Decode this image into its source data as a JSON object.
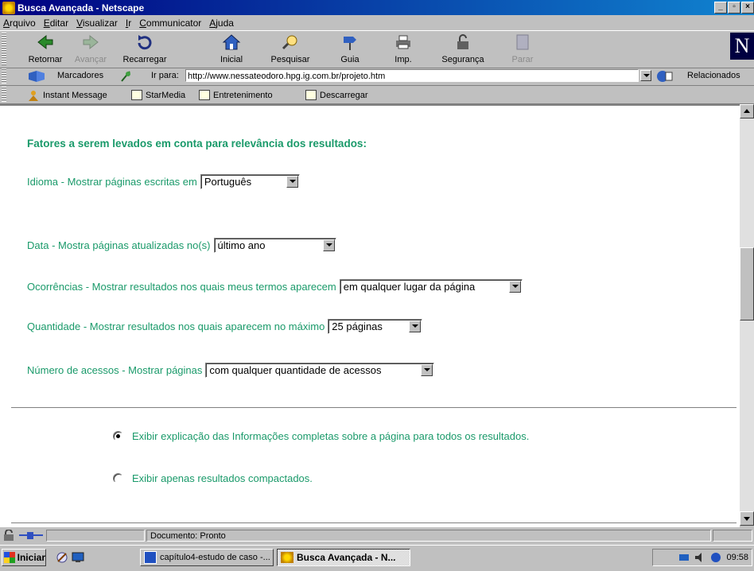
{
  "window": {
    "title": "Busca Avançada - Netscape",
    "buttons": [
      "_",
      "▫",
      "×"
    ]
  },
  "menu": [
    "Arquivo",
    "Editar",
    "Visualizar",
    "Ir",
    "Communicator",
    "Ajuda"
  ],
  "toolbar": {
    "buttons": [
      {
        "label": "Retornar",
        "icon": "back-arrow-icon",
        "enabled": true
      },
      {
        "label": "Avançar",
        "icon": "forward-arrow-icon",
        "enabled": false
      },
      {
        "label": "Recarregar",
        "icon": "reload-icon",
        "enabled": true
      },
      {
        "label": "Inicial",
        "icon": "home-icon",
        "enabled": true
      },
      {
        "label": "Pesquisar",
        "icon": "search-icon",
        "enabled": true
      },
      {
        "label": "Guia",
        "icon": "guide-icon",
        "enabled": true
      },
      {
        "label": "Imp.",
        "icon": "print-icon",
        "enabled": true
      },
      {
        "label": "Segurança",
        "icon": "lock-icon",
        "enabled": true
      },
      {
        "label": "Parar",
        "icon": "stop-icon",
        "enabled": false
      }
    ],
    "logo": "N"
  },
  "location": {
    "bookmarks_label": "Marcadores",
    "goto_label": "Ir para:",
    "url": "http://www.nessateodoro.hpg.ig.com.br/projeto.htm",
    "related_label": "Relacionados"
  },
  "personal": [
    "Instant Message",
    "StarMedia",
    "Entretenimento",
    "Descarregar"
  ],
  "page": {
    "heading": "Fatores a serem levados em conta para relevância dos resultados:",
    "filters": [
      {
        "label": "Idioma - Mostrar páginas escritas em",
        "value": "Português"
      },
      {
        "label": "Data - Mostra páginas atualizadas no(s)",
        "value": "último ano"
      },
      {
        "label": "Ocorrências - Mostrar resultados nos quais meus termos aparecem",
        "value": "em qualquer lugar da página"
      },
      {
        "label": "Quantidade - Mostrar resultados nos quais aparecem no máximo",
        "value": "25 páginas"
      },
      {
        "label": "Número de acessos - Mostrar páginas",
        "value": "com qualquer quantidade de acessos"
      }
    ],
    "options": [
      {
        "label": "Exibir explicação das Informações completas sobre a página para todos os resultados.",
        "checked": true
      },
      {
        "label": "Exibir apenas resultados compactados.",
        "checked": false
      }
    ]
  },
  "status": {
    "text": "Documento: Pronto"
  },
  "taskbar": {
    "start": "Iniciar",
    "tasks": [
      {
        "label": "capítulo4-estudo de caso -...",
        "active": false
      },
      {
        "label": "Busca Avançada - N...",
        "active": true
      }
    ],
    "clock": "09:58"
  },
  "colors": {
    "accent_green": "#1a9a6a",
    "title_blue": "#000080"
  }
}
